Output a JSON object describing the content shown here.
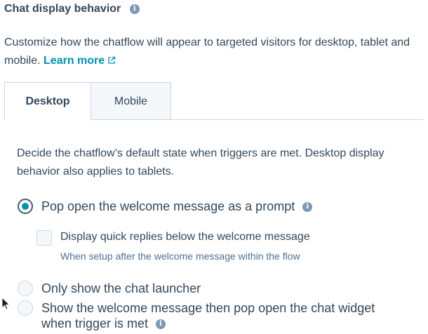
{
  "header": {
    "title": "Chat display behavior",
    "description": "Customize how the chatflow will appear to targeted visitors for desktop, tablet and mobile.",
    "learn_more": "Learn more"
  },
  "tabs": [
    {
      "label": "Desktop",
      "selected": true
    },
    {
      "label": "Mobile",
      "selected": false
    }
  ],
  "desktop": {
    "description": "Decide the chatflow’s default state when triggers are met. Desktop display behavior also applies to tablets.",
    "options": [
      {
        "label": "Pop open the welcome message as a prompt",
        "selected": true,
        "sub_option": {
          "label": "Display quick replies below the welcome message",
          "help": "When setup after the welcome message within the flow",
          "checked": false
        }
      },
      {
        "label": "Only show the chat launcher",
        "selected": false
      },
      {
        "label": "Show the welcome message then pop open the chat widget when trigger is met",
        "selected": false
      }
    ]
  },
  "colors": {
    "text": "#33475b",
    "link": "#0091ae",
    "border": "#cbd6e2",
    "info_icon": "#7c98b6"
  }
}
